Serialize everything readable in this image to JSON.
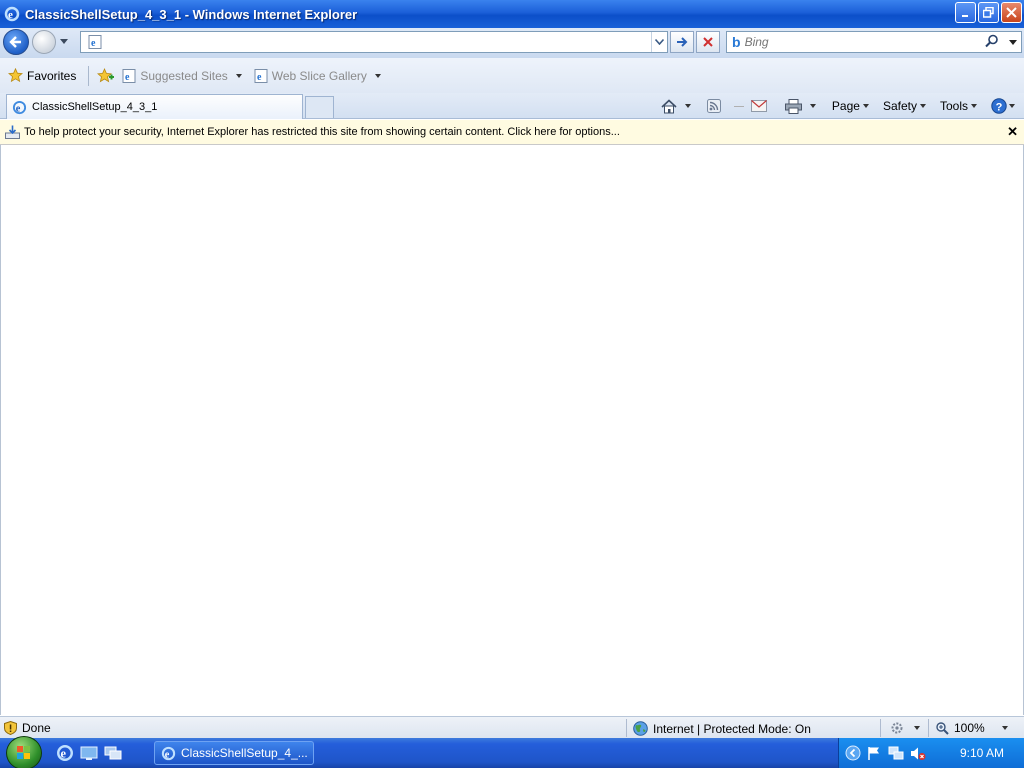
{
  "window": {
    "title": "ClassicShellSetup_4_3_1 - Windows Internet Explorer"
  },
  "address_bar": {
    "value": "",
    "search_placeholder": "Bing"
  },
  "favorites_bar": {
    "favorites_label": "Favorites",
    "links": [
      "Suggested Sites",
      "Web Slice Gallery"
    ]
  },
  "tabs": [
    {
      "label": "ClassicShellSetup_4_3_1"
    }
  ],
  "command_bar": {
    "page_label": "Page",
    "safety_label": "Safety",
    "tools_label": "Tools"
  },
  "info_bar": {
    "message": "To help protect your security, Internet Explorer has restricted this site from showing certain content. Click here for options..."
  },
  "status_bar": {
    "status_text": "Done",
    "zone_text": "Internet | Protected Mode: On",
    "zoom": "100%"
  },
  "taskbar": {
    "active_window_label": "ClassicShellSetup_4_...",
    "clock": "9:10 AM"
  },
  "colors": {
    "title_bar": "#1b5fd8",
    "info_bar": "#fffbe1",
    "taskbar": "#245edb",
    "tray": "#0f6dd6"
  }
}
